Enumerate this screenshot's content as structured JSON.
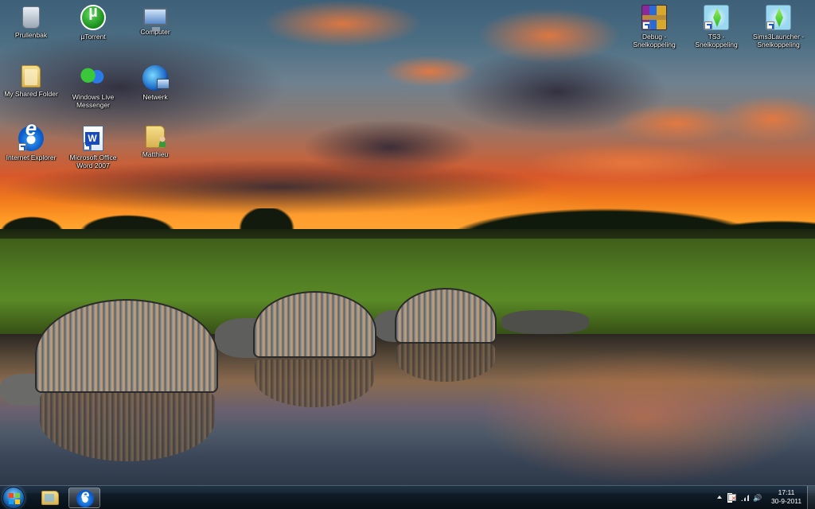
{
  "desktop": {
    "icons": [
      {
        "label": "Prullenbak",
        "icon": "recycle-bin-icon"
      },
      {
        "label": "µTorrent",
        "icon": "utorrent-icon"
      },
      {
        "label": "Computer",
        "icon": "computer-icon"
      },
      {
        "label": "My Shared Folder",
        "icon": "folder-icon"
      },
      {
        "label": "Windows Live Messenger",
        "icon": "messenger-icon"
      },
      {
        "label": "Netwerk",
        "icon": "network-icon"
      },
      {
        "label": "Internet Explorer",
        "icon": "internet-explorer-icon"
      },
      {
        "label": "Microsoft Office Word 2007",
        "icon": "word-icon"
      },
      {
        "label": "Matthieu",
        "icon": "user-folder-icon"
      },
      {
        "label": "Debug - Snelkoppeling",
        "icon": "winrar-icon"
      },
      {
        "label": "TS3 - Snelkoppeling",
        "icon": "sims-icon"
      },
      {
        "label": "Sims3Launcher - Snelkoppeling",
        "icon": "sims-icon"
      }
    ]
  },
  "taskbar": {
    "start_icon": "windows-start-icon",
    "pinned": [
      {
        "app": "Windows Explorer",
        "icon": "explorer-folder-icon"
      },
      {
        "app": "Internet Explorer",
        "icon": "internet-explorer-icon",
        "active": true
      }
    ],
    "tray": {
      "icons": [
        "show-hidden-icons-arrow-icon",
        "action-center-flag-icon",
        "network-signal-icon",
        "volume-icon"
      ],
      "time": "17:11",
      "date": "30-9-2011"
    }
  }
}
